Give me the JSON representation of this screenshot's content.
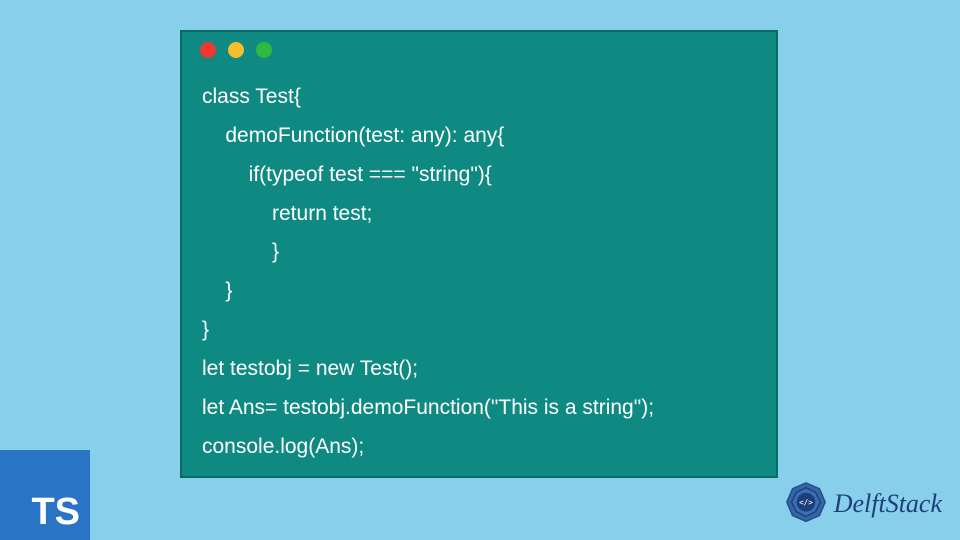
{
  "window": {
    "buttons": [
      "close",
      "minimize",
      "maximize"
    ]
  },
  "code": {
    "lines": [
      "class Test{",
      "    demoFunction(test: any): any{",
      "        if(typeof test === \"string\"){",
      "            return test;",
      "            }",
      "    }",
      "}",
      "let testobj = new Test();",
      "let Ans= testobj.demoFunction(\"This is a string\");",
      "console.log(Ans);"
    ]
  },
  "badges": {
    "ts": "TS",
    "brand": "DelftStack"
  },
  "colors": {
    "bg": "#87cfeb",
    "window": "#0f8a82",
    "ts_badge": "#2a74c5",
    "brand_text": "#1d3f7a"
  }
}
